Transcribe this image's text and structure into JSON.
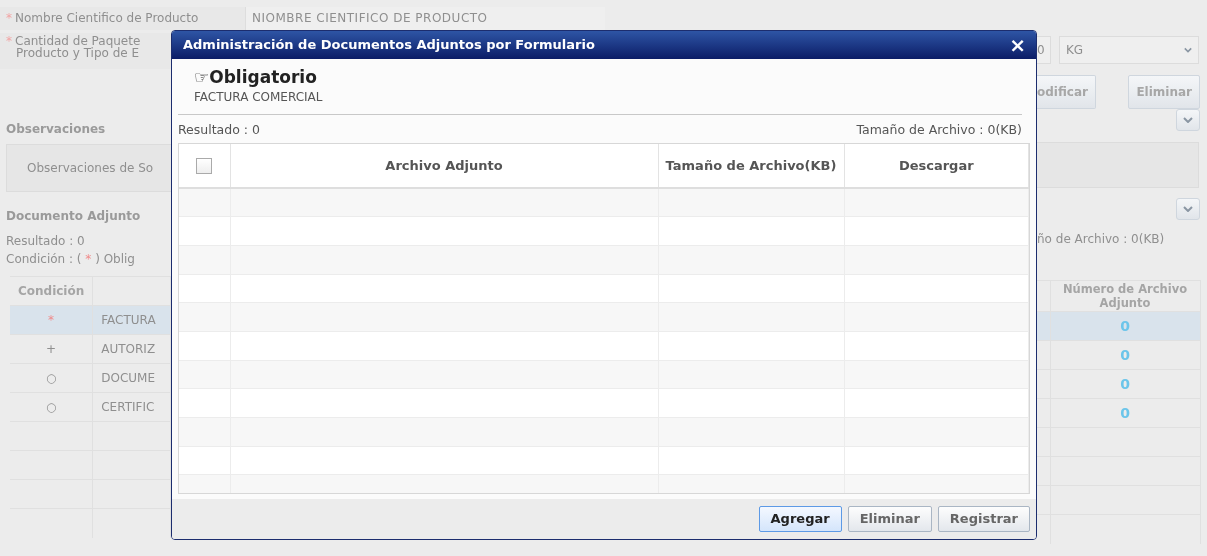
{
  "form": {
    "product_name": {
      "required": true,
      "label": "Nombre Cientifico de Producto",
      "value": "NIOMBRE CIENTIFICO DE PRODUCTO"
    },
    "package_quantity": {
      "required": true,
      "label_lines": [
        "Cantidad de Paquete",
        "Producto y Tipo de E"
      ],
      "value": "0",
      "unit": "KG"
    },
    "buttons": [
      "odificar",
      "Eliminar"
    ]
  },
  "observations": {
    "title": "Observaciones",
    "placeholder": "Observaciones de So"
  },
  "attachments": {
    "title": "Documento Adjunto",
    "result": "Resultado : 0",
    "file_size": "ño de Archivo : 0(KB)",
    "legend": {
      "prefix": "Condición : (",
      "mark": "*",
      "suffix": ") Oblig"
    },
    "columns": [
      "Condición",
      "Número de Archivo Adjunto"
    ],
    "rows": [
      {
        "condition": "*",
        "kind": "required",
        "name": "FACTURA",
        "count": "0",
        "selected": true
      },
      {
        "condition": "+",
        "kind": "optional",
        "name": "AUTORIZ",
        "count": "0",
        "selected": false
      },
      {
        "condition": "○",
        "kind": "other",
        "name": "DOCUME",
        "count": "0",
        "selected": false
      },
      {
        "condition": "○",
        "kind": "other",
        "name": "CERTIFIC",
        "count": "0",
        "selected": false
      }
    ]
  },
  "dialog": {
    "title": "Administración de Documentos Adjuntos por Formulario",
    "close": "×",
    "heading": "☞Obligatorio",
    "document": "FACTURA COMERCIAL",
    "result": "Resultado : 0",
    "file_size": "Tamaño de Archivo : 0(KB)",
    "select_all_checked": false,
    "columns": [
      "Archivo Adjunto",
      "Tamaño de Archivo(KB)",
      "Descargar"
    ],
    "buttons": [
      {
        "label": "Agregar",
        "focused": true
      },
      {
        "label": "Eliminar",
        "focused": false
      },
      {
        "label": "Registrar",
        "focused": false
      }
    ]
  }
}
